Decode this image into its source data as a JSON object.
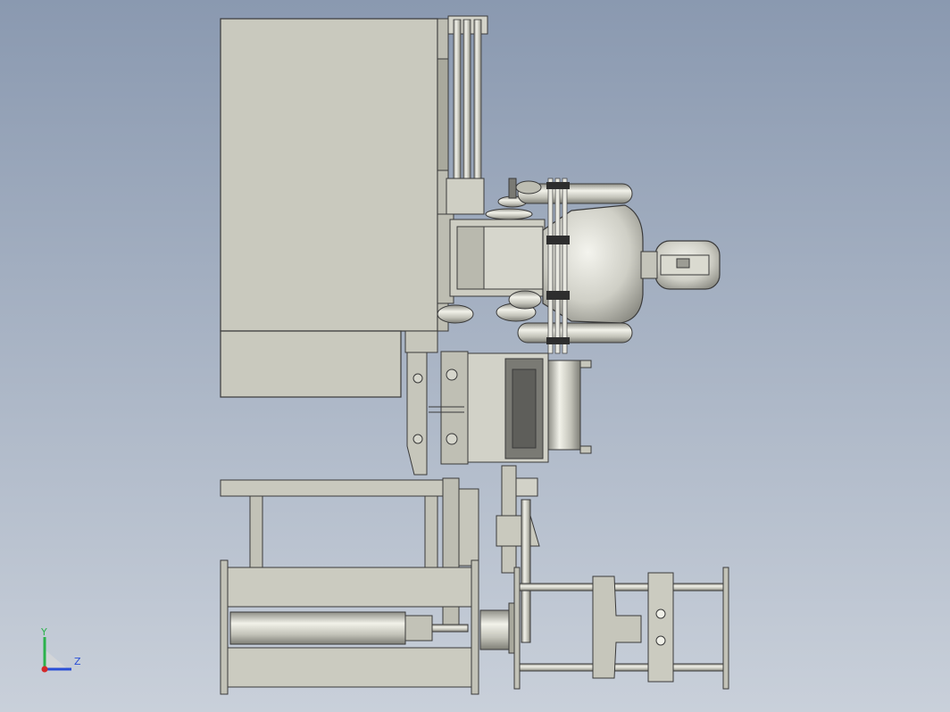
{
  "viewport": {
    "background_top": "#8a99b0",
    "background_bottom": "#c9d0da",
    "part_fill": "#c8c8bc",
    "part_shade": "#a9a99c",
    "edge_color": "#3a3a3a",
    "dark_part": "#6e6e6a"
  },
  "triad": {
    "y_label": "Y",
    "z_label": "Z",
    "y_color": "#2bb24c",
    "z_color": "#2a4fd6",
    "x_color": "#d42a2a"
  }
}
